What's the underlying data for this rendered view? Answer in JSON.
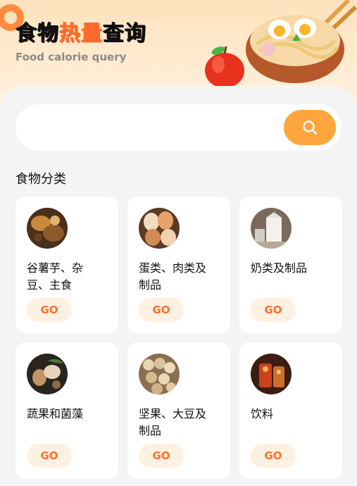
{
  "header": {
    "title_part1": "食物",
    "title_highlight": "热量",
    "title_part2": "查询",
    "subtitle": "Food calorie query"
  },
  "search": {
    "placeholder": "",
    "button_icon": "search-icon"
  },
  "section": {
    "title": "食物分类"
  },
  "categories": [
    {
      "name": "谷薯芋、杂豆、主食",
      "go": "GO",
      "icon": "grain-photo"
    },
    {
      "name": "蛋类、肉类及制品",
      "go": "GO",
      "icon": "egg-photo"
    },
    {
      "name": "奶类及制品",
      "go": "GO",
      "icon": "milk-photo"
    },
    {
      "name": "蔬果和菌藻",
      "go": "GO",
      "icon": "vegetable-photo"
    },
    {
      "name": "坚果、大豆及制品",
      "go": "GO",
      "icon": "nut-photo"
    },
    {
      "name": "饮料",
      "go": "GO",
      "icon": "drink-photo"
    }
  ],
  "colors": {
    "accent": "#ffa53d",
    "title_highlight": "#ff6a2c",
    "go_bg": "#fff0e2",
    "go_text": "#ff6f2b"
  }
}
